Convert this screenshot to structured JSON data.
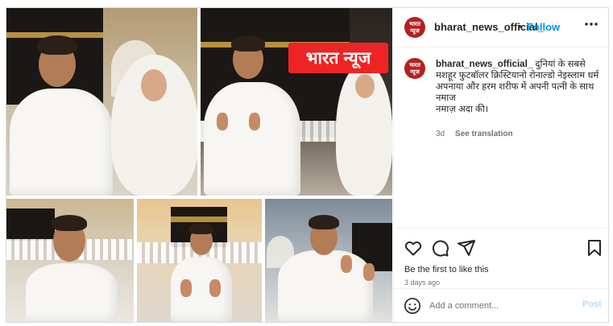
{
  "post": {
    "overlay_label": "भारत न्यूज",
    "header": {
      "avatar_text": "भारत न्यूज",
      "username": "bharat_news_official_",
      "separator": "•",
      "follow_label": "Follow",
      "more_icon": "more-horizontal-icon"
    },
    "caption": {
      "username": "bharat_news_official_",
      "text": "दुनियां के सबसे मशहूर फुटबॉलर क्रिस्टियानो रोनाल्डो नेइस्लाम धर्म अपनाया और हरम शरीफ में अपनी पत्नी के साथ नमाज",
      "text_line2": "नमाज़ अदा की।",
      "time_ago": "3d",
      "translate_label": "See translation"
    },
    "actions": {
      "like_icon": "heart-icon",
      "comment_icon": "comment-icon",
      "share_icon": "share-icon",
      "save_icon": "bookmark-icon",
      "likes_text": "Be the first to like this",
      "date": "3 days ago"
    },
    "comment": {
      "emoji_icon": "emoji-icon",
      "placeholder": "Add a comment...",
      "post_label": "Post"
    }
  }
}
